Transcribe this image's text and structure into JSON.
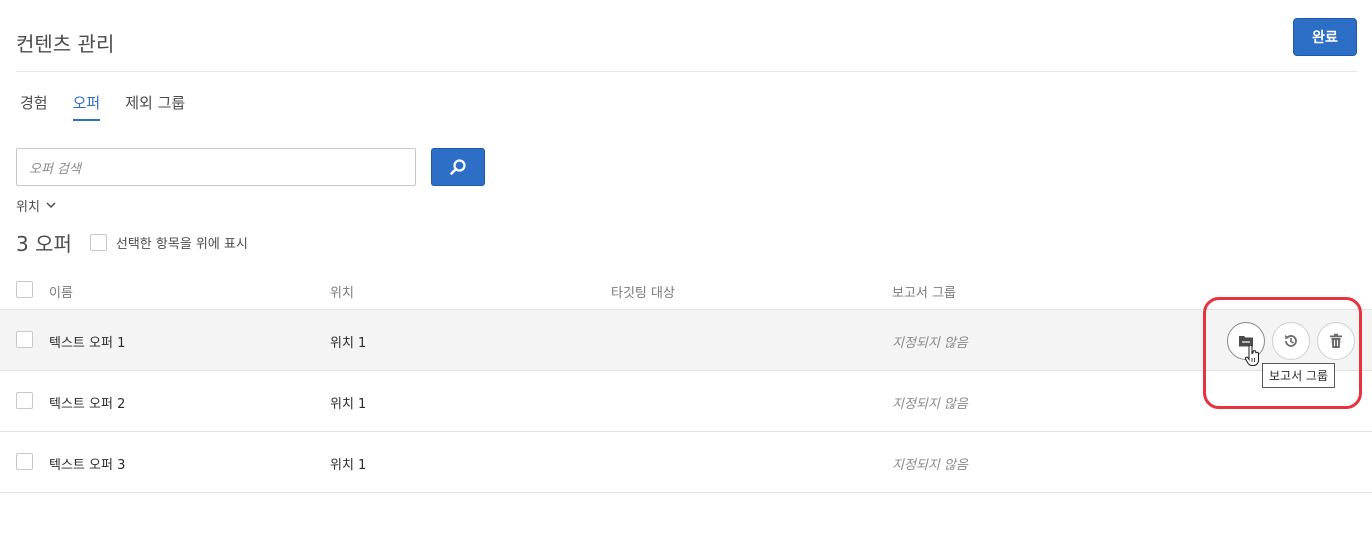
{
  "header": {
    "title": "컨텐츠 관리",
    "done_label": "완료"
  },
  "tabs": [
    {
      "label": "경험"
    },
    {
      "label": "오퍼"
    },
    {
      "label": "제외 그룹"
    }
  ],
  "search": {
    "placeholder": "오퍼 검색"
  },
  "filter": {
    "location_label": "위치"
  },
  "summary": {
    "count_label": "3 오퍼",
    "show_selected_label": "선택한 항목을 위에 표시"
  },
  "table": {
    "columns": [
      "이름",
      "위치",
      "타깃팅 대상",
      "보고서 그룹"
    ],
    "rows": [
      {
        "name": "텍스트 오퍼 1",
        "location": "위치 1",
        "targeting": "",
        "report_group": "지정되지 않음"
      },
      {
        "name": "텍스트 오퍼 2",
        "location": "위치 1",
        "targeting": "",
        "report_group": "지정되지 않음"
      },
      {
        "name": "텍스트 오퍼 3",
        "location": "위치 1",
        "targeting": "",
        "report_group": "지정되지 않음"
      }
    ]
  },
  "row_actions": {
    "tooltip": "보고서 그룹",
    "icons": [
      "folder-icon",
      "history-icon",
      "trash-icon"
    ]
  },
  "colors": {
    "accent": "#2d6fc7",
    "highlight": "#e8323e"
  }
}
